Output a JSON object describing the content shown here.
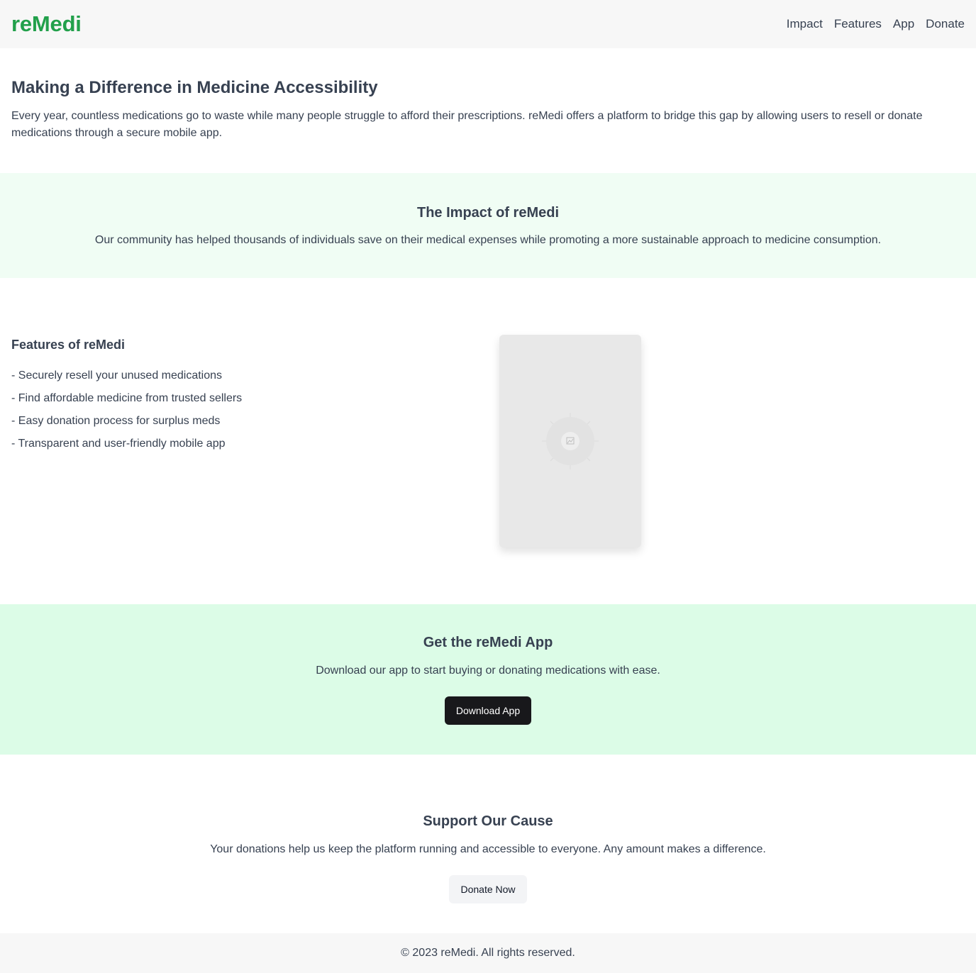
{
  "header": {
    "brand": "reMedi",
    "nav": [
      "Impact",
      "Features",
      "App",
      "Donate"
    ]
  },
  "hero": {
    "title": "Making a Difference in Medicine Accessibility",
    "body": "Every year, countless medications go to waste while many people struggle to afford their prescriptions. reMedi offers a platform to bridge this gap by allowing users to resell or donate medications through a secure mobile app."
  },
  "impact": {
    "title": "The Impact of reMedi",
    "body": "Our community has helped thousands of individuals save on their medical expenses while promoting a more sustainable approach to medicine consumption."
  },
  "features": {
    "title": "Features of reMedi",
    "items": [
      "- Securely resell your unused medications",
      "- Find affordable medicine from trusted sellers",
      "- Easy donation process for surplus meds",
      "- Transparent and user-friendly mobile app"
    ],
    "preview_icon": "image-placeholder-icon"
  },
  "cta": {
    "title": "Get the reMedi App",
    "body": "Download our app to start buying or donating medications with ease.",
    "button": "Download App"
  },
  "support": {
    "title": "Support Our Cause",
    "body": "Your donations help us keep the platform running and accessible to everyone. Any amount makes a difference.",
    "button": "Donate Now"
  },
  "footer": {
    "text": "© 2023 reMedi. All rights reserved."
  },
  "colors": {
    "brand": "#22a04b",
    "impact_bg": "#f0fdf4",
    "cta_bg": "#dcfce7",
    "header_bg": "#f7f7f7",
    "dark_button": "#18181b"
  }
}
